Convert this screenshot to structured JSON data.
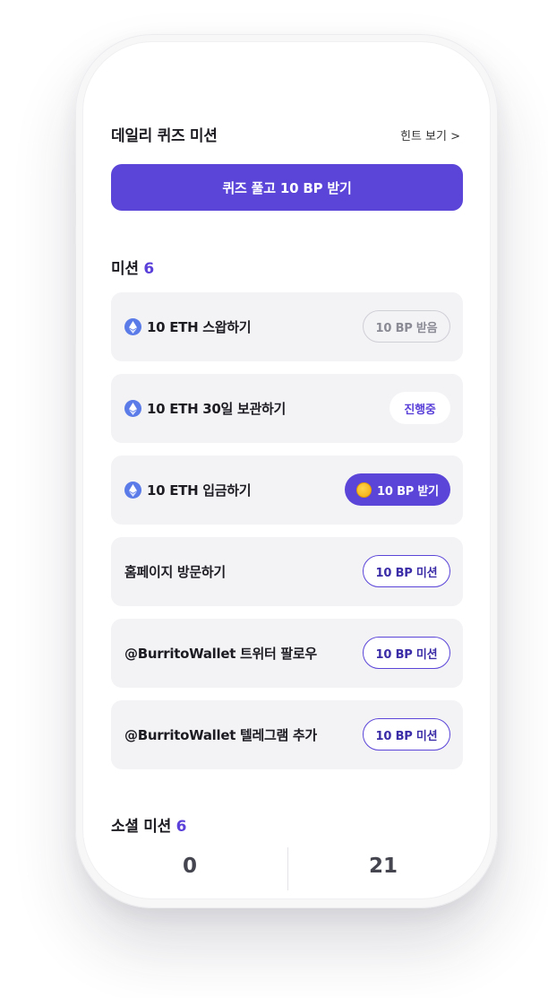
{
  "header": {
    "title": "데일리 퀴즈 미션",
    "hint_label": "힌트 보기 >"
  },
  "quiz": {
    "button_label": "퀴즈 풀고 10 BP 받기"
  },
  "missions": {
    "title": "미션",
    "count": "6",
    "items": [
      {
        "label": "10 ETH 스왑하기",
        "icon": "ethereum-icon",
        "action": "10 BP 받음",
        "state": "received"
      },
      {
        "label": "10 ETH 30일 보관하기",
        "icon": "ethereum-icon",
        "action": "진행중",
        "state": "in-progress"
      },
      {
        "label": "10 ETH 입금하기",
        "icon": "ethereum-icon",
        "action": "10 BP 받기",
        "state": "claim"
      },
      {
        "label": "홈페이지 방문하기",
        "action": "10 BP 미션",
        "state": "mission"
      },
      {
        "label": "@BurritoWallet 트위터 팔로우",
        "action": "10 BP 미션",
        "state": "mission"
      },
      {
        "label": "@BurritoWallet 텔레그램 추가",
        "action": "10 BP 미션",
        "state": "mission"
      }
    ]
  },
  "social": {
    "title": "소셜 미션",
    "count": "6",
    "stats": [
      {
        "value": "0"
      },
      {
        "value": "21"
      }
    ]
  },
  "colors": {
    "accent": "#5a45d8",
    "card_bg": "#f3f3f6",
    "ethereum": "#5a7be8",
    "coin": "#f5b50f"
  }
}
